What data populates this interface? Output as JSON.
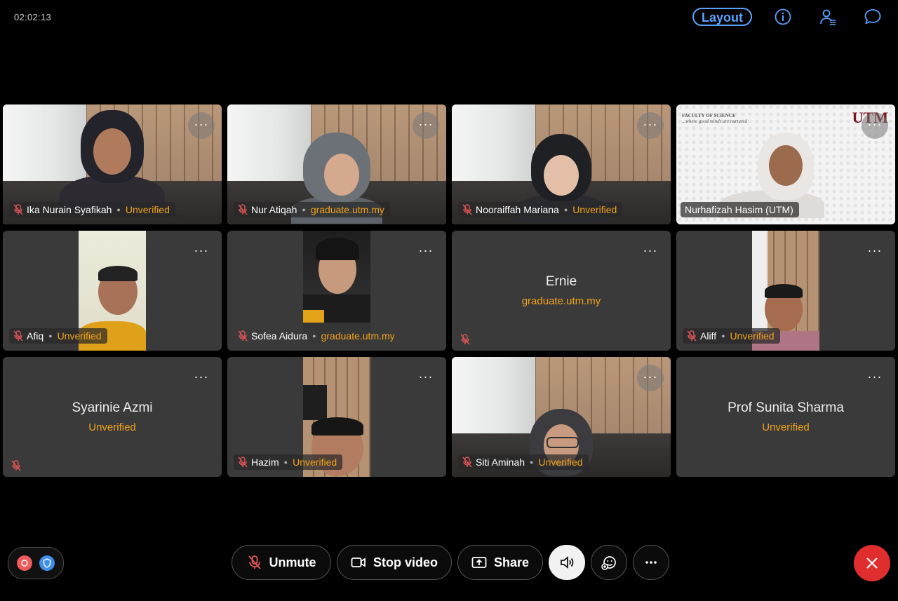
{
  "header": {
    "timer": "02:02:13",
    "layout_label": "Layout",
    "icons": [
      "info-icon",
      "participants-icon",
      "chat-icon"
    ]
  },
  "tiles": [
    {
      "name": "Ika Nurain Syafikah",
      "status": "Unverified",
      "video": true
    },
    {
      "name": "Nur Atiqah",
      "status": "graduate.utm.my",
      "video": true
    },
    {
      "name": "Nooraiffah Mariana",
      "status": "Unverified",
      "video": true
    },
    {
      "name": "Nurhafizah Hasim (UTM)",
      "status": "",
      "video": true
    },
    {
      "name": "Afiq",
      "status": "Unverified",
      "video": true
    },
    {
      "name": "Sofea Aidura",
      "status": "graduate.utm.my",
      "video": true
    },
    {
      "name": "Ernie",
      "status": "graduate.utm.my",
      "video": false
    },
    {
      "name": "Aliff",
      "status": "Unverified",
      "video": true
    },
    {
      "name": "Syarinie Azmi",
      "status": "Unverified",
      "video": false
    },
    {
      "name": "Hazim",
      "status": "Unverified",
      "video": true
    },
    {
      "name": "Siti Aminah",
      "status": "Unverified",
      "video": true
    },
    {
      "name": "Prof Sunita Sharma",
      "status": "Unverified",
      "video": false
    }
  ],
  "slide": {
    "heading": "FACULTY OF SCIENCE",
    "tagline": "...where good minds are nurtured",
    "logo": "UTM"
  },
  "more_label": "···",
  "controls": {
    "unmute_label": "Unmute",
    "stop_video_label": "Stop video",
    "share_label": "Share"
  },
  "colors": {
    "accent": "#5aa2ff",
    "unverified": "#f0a31c",
    "end_call": "#e02e2e"
  }
}
